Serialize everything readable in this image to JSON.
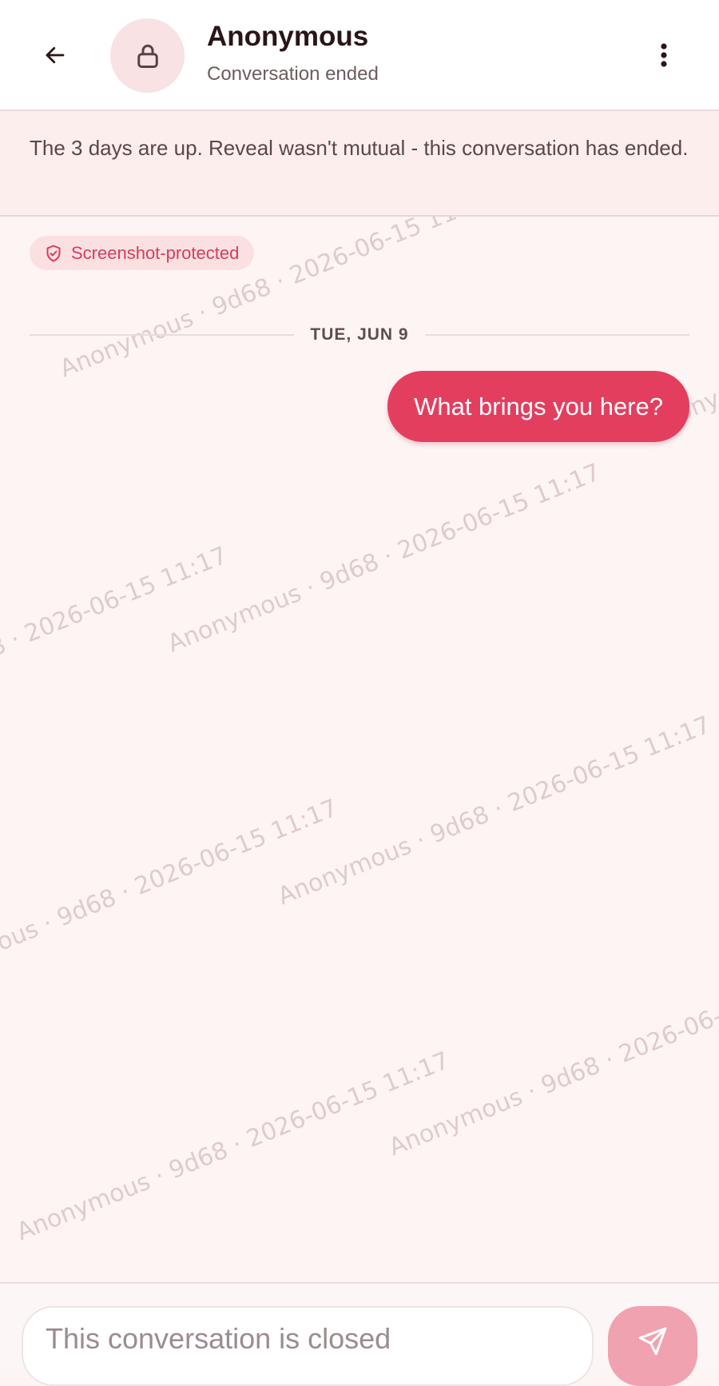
{
  "header": {
    "back_icon": "arrow-left-icon",
    "avatar_icon": "lock-icon",
    "title": "Anonymous",
    "subtitle": "Conversation ended",
    "menu_icon": "more-vertical-icon"
  },
  "banner": {
    "text": "The 3 days are up. Reveal wasn't mutual - this conversation has ended."
  },
  "chat": {
    "protection_label": "Screenshot-protected",
    "protection_icon": "shield-check-icon",
    "date_divider": "TUE, JUN 9",
    "messages": [
      {
        "text": "What brings you here?",
        "sender": "me"
      }
    ],
    "watermark": "Anonymous · 9d68 · 2026-06-15 11:17"
  },
  "composer": {
    "placeholder": "This conversation is closed",
    "send_icon": "send-icon"
  },
  "colors": {
    "accent": "#e43e5f",
    "background": "#fdf4f4",
    "banner": "#fdeeee",
    "send_disabled": "#f0a2b0"
  }
}
